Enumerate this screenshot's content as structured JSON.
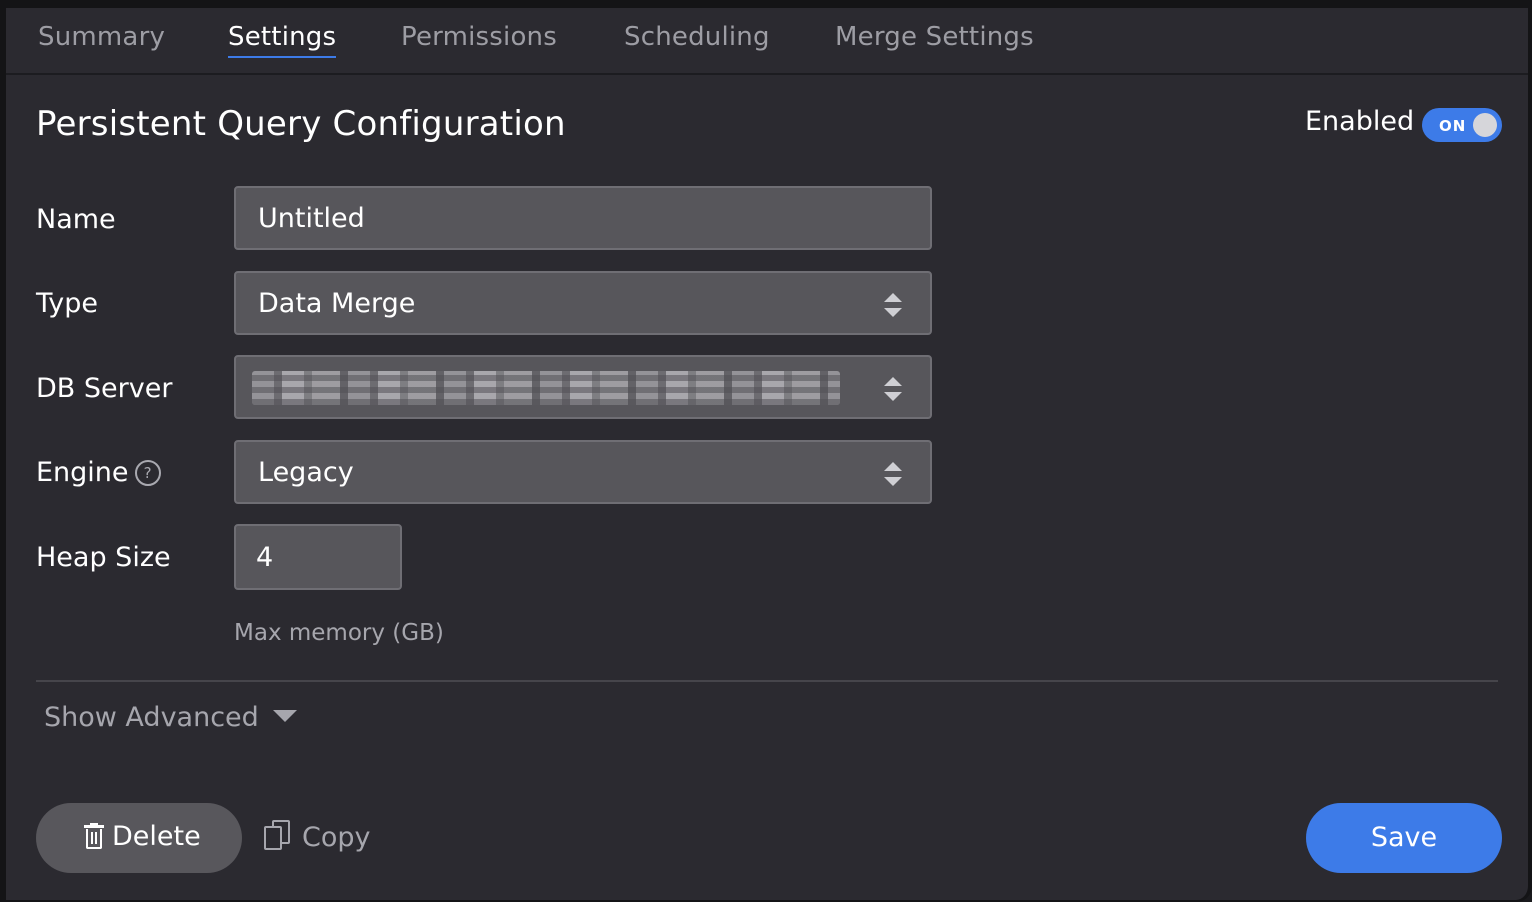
{
  "tabs": [
    {
      "label": "Summary"
    },
    {
      "label": "Settings"
    },
    {
      "label": "Permissions"
    },
    {
      "label": "Scheduling"
    },
    {
      "label": "Merge Settings"
    }
  ],
  "active_tab": "Settings",
  "header": {
    "title": "Persistent Query Configuration",
    "enabled_label": "Enabled",
    "toggle_text": "ON"
  },
  "form": {
    "name_label": "Name",
    "name_value": "Untitled",
    "type_label": "Type",
    "type_value": "Data Merge",
    "db_server_label": "DB Server",
    "engine_label": "Engine",
    "engine_help": "?",
    "engine_value": "Legacy",
    "heap_label": "Heap Size",
    "heap_value": "4",
    "heap_hint": "Max memory (GB)"
  },
  "advanced": {
    "label": "Show Advanced"
  },
  "footer": {
    "delete_label": "Delete",
    "copy_label": "Copy",
    "save_label": "Save"
  },
  "colors": {
    "accent": "#3d7be8",
    "panel": "#2b2a30",
    "field": "#57565b"
  }
}
